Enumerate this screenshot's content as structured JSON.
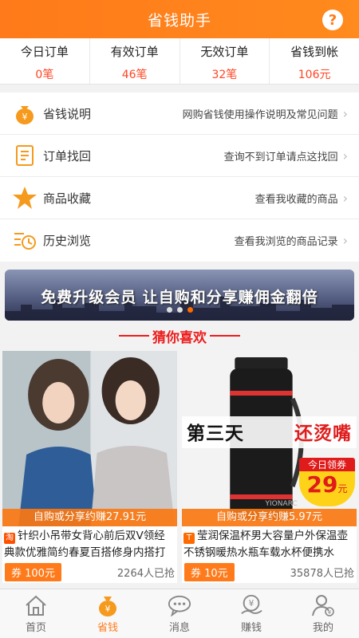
{
  "header": {
    "title": "省钱助手",
    "help_icon": "question-icon"
  },
  "stats": [
    {
      "label": "今日订单",
      "value": "0笔"
    },
    {
      "label": "有效订单",
      "value": "46笔"
    },
    {
      "label": "无效订单",
      "value": "32笔"
    },
    {
      "label": "省钱到帐",
      "value": "106元"
    }
  ],
  "menu": [
    {
      "name": "省钱说明",
      "desc": "网购省钱使用操作说明及常见问题",
      "icon": "money-bag-icon"
    },
    {
      "name": "订单找回",
      "desc": "查询不到订单请点这找回",
      "icon": "document-icon"
    },
    {
      "name": "商品收藏",
      "desc": "查看我收藏的商品",
      "icon": "star-icon"
    },
    {
      "name": "历史浏览",
      "desc": "查看我浏览的商品记录",
      "icon": "history-icon"
    }
  ],
  "banner": {
    "text": "免费升级会员 让自购和分享赚佣金翻倍"
  },
  "section": {
    "title": "猜你喜欢"
  },
  "products": [
    {
      "earn": "自购或分享约赚27.91元",
      "title": "针织小吊带女背心前后双V领经典款优雅简约春夏百搭修身内搭打",
      "tag": "淘",
      "coupon": "券 100元",
      "sold": "2264人已抢"
    },
    {
      "earn": "自购或分享约赚5.97元",
      "title": "莹润保温杯男大容量户外保温壶不锈钢暖热水瓶车载水杯便携水",
      "tag": "T",
      "coupon": "券 10元",
      "sold": "35878人已抢",
      "promo_left": "第三天",
      "promo_right": "还烫嘴",
      "badge_label": "今日领券",
      "badge_price": "29",
      "badge_unit": "元"
    }
  ],
  "tabs": [
    {
      "label": "首页",
      "icon": "home-icon"
    },
    {
      "label": "省钱",
      "icon": "money-bag-icon"
    },
    {
      "label": "消息",
      "icon": "message-icon"
    },
    {
      "label": "赚钱",
      "icon": "earn-icon"
    },
    {
      "label": "我的",
      "icon": "profile-icon"
    }
  ],
  "colors": {
    "accent": "#ff7a1a",
    "value_red": "#ff4422",
    "guess_red": "#ee1c1c"
  }
}
